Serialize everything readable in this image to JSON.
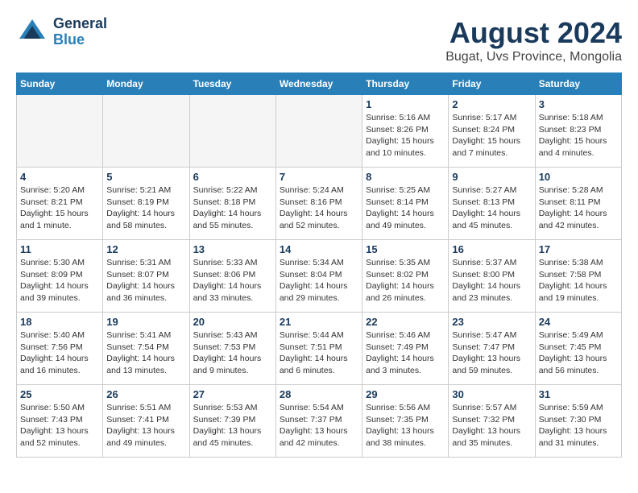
{
  "header": {
    "logo_line1": "General",
    "logo_line2": "Blue",
    "main_title": "August 2024",
    "subtitle": "Bugat, Uvs Province, Mongolia"
  },
  "weekdays": [
    "Sunday",
    "Monday",
    "Tuesday",
    "Wednesday",
    "Thursday",
    "Friday",
    "Saturday"
  ],
  "weeks": [
    [
      {
        "day": "",
        "info": ""
      },
      {
        "day": "",
        "info": ""
      },
      {
        "day": "",
        "info": ""
      },
      {
        "day": "",
        "info": ""
      },
      {
        "day": "1",
        "info": "Sunrise: 5:16 AM\nSunset: 8:26 PM\nDaylight: 15 hours\nand 10 minutes."
      },
      {
        "day": "2",
        "info": "Sunrise: 5:17 AM\nSunset: 8:24 PM\nDaylight: 15 hours\nand 7 minutes."
      },
      {
        "day": "3",
        "info": "Sunrise: 5:18 AM\nSunset: 8:23 PM\nDaylight: 15 hours\nand 4 minutes."
      }
    ],
    [
      {
        "day": "4",
        "info": "Sunrise: 5:20 AM\nSunset: 8:21 PM\nDaylight: 15 hours\nand 1 minute."
      },
      {
        "day": "5",
        "info": "Sunrise: 5:21 AM\nSunset: 8:19 PM\nDaylight: 14 hours\nand 58 minutes."
      },
      {
        "day": "6",
        "info": "Sunrise: 5:22 AM\nSunset: 8:18 PM\nDaylight: 14 hours\nand 55 minutes."
      },
      {
        "day": "7",
        "info": "Sunrise: 5:24 AM\nSunset: 8:16 PM\nDaylight: 14 hours\nand 52 minutes."
      },
      {
        "day": "8",
        "info": "Sunrise: 5:25 AM\nSunset: 8:14 PM\nDaylight: 14 hours\nand 49 minutes."
      },
      {
        "day": "9",
        "info": "Sunrise: 5:27 AM\nSunset: 8:13 PM\nDaylight: 14 hours\nand 45 minutes."
      },
      {
        "day": "10",
        "info": "Sunrise: 5:28 AM\nSunset: 8:11 PM\nDaylight: 14 hours\nand 42 minutes."
      }
    ],
    [
      {
        "day": "11",
        "info": "Sunrise: 5:30 AM\nSunset: 8:09 PM\nDaylight: 14 hours\nand 39 minutes."
      },
      {
        "day": "12",
        "info": "Sunrise: 5:31 AM\nSunset: 8:07 PM\nDaylight: 14 hours\nand 36 minutes."
      },
      {
        "day": "13",
        "info": "Sunrise: 5:33 AM\nSunset: 8:06 PM\nDaylight: 14 hours\nand 33 minutes."
      },
      {
        "day": "14",
        "info": "Sunrise: 5:34 AM\nSunset: 8:04 PM\nDaylight: 14 hours\nand 29 minutes."
      },
      {
        "day": "15",
        "info": "Sunrise: 5:35 AM\nSunset: 8:02 PM\nDaylight: 14 hours\nand 26 minutes."
      },
      {
        "day": "16",
        "info": "Sunrise: 5:37 AM\nSunset: 8:00 PM\nDaylight: 14 hours\nand 23 minutes."
      },
      {
        "day": "17",
        "info": "Sunrise: 5:38 AM\nSunset: 7:58 PM\nDaylight: 14 hours\nand 19 minutes."
      }
    ],
    [
      {
        "day": "18",
        "info": "Sunrise: 5:40 AM\nSunset: 7:56 PM\nDaylight: 14 hours\nand 16 minutes."
      },
      {
        "day": "19",
        "info": "Sunrise: 5:41 AM\nSunset: 7:54 PM\nDaylight: 14 hours\nand 13 minutes."
      },
      {
        "day": "20",
        "info": "Sunrise: 5:43 AM\nSunset: 7:53 PM\nDaylight: 14 hours\nand 9 minutes."
      },
      {
        "day": "21",
        "info": "Sunrise: 5:44 AM\nSunset: 7:51 PM\nDaylight: 14 hours\nand 6 minutes."
      },
      {
        "day": "22",
        "info": "Sunrise: 5:46 AM\nSunset: 7:49 PM\nDaylight: 14 hours\nand 3 minutes."
      },
      {
        "day": "23",
        "info": "Sunrise: 5:47 AM\nSunset: 7:47 PM\nDaylight: 13 hours\nand 59 minutes."
      },
      {
        "day": "24",
        "info": "Sunrise: 5:49 AM\nSunset: 7:45 PM\nDaylight: 13 hours\nand 56 minutes."
      }
    ],
    [
      {
        "day": "25",
        "info": "Sunrise: 5:50 AM\nSunset: 7:43 PM\nDaylight: 13 hours\nand 52 minutes."
      },
      {
        "day": "26",
        "info": "Sunrise: 5:51 AM\nSunset: 7:41 PM\nDaylight: 13 hours\nand 49 minutes."
      },
      {
        "day": "27",
        "info": "Sunrise: 5:53 AM\nSunset: 7:39 PM\nDaylight: 13 hours\nand 45 minutes."
      },
      {
        "day": "28",
        "info": "Sunrise: 5:54 AM\nSunset: 7:37 PM\nDaylight: 13 hours\nand 42 minutes."
      },
      {
        "day": "29",
        "info": "Sunrise: 5:56 AM\nSunset: 7:35 PM\nDaylight: 13 hours\nand 38 minutes."
      },
      {
        "day": "30",
        "info": "Sunrise: 5:57 AM\nSunset: 7:32 PM\nDaylight: 13 hours\nand 35 minutes."
      },
      {
        "day": "31",
        "info": "Sunrise: 5:59 AM\nSunset: 7:30 PM\nDaylight: 13 hours\nand 31 minutes."
      }
    ]
  ]
}
